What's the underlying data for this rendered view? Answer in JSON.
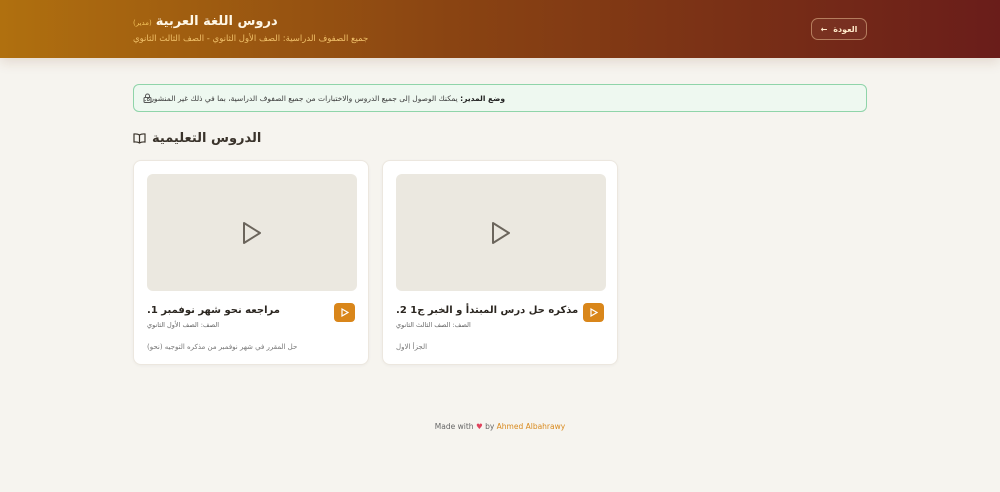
{
  "header": {
    "title": "دروس اللغة العربية",
    "badge": "(مدير)",
    "subtitle": "جميع الصفوف الدراسية: الصف الأول الثانوي - الصف الثالث الثانوي",
    "back_label": "العودة",
    "back_icon": "arrow-left-icon"
  },
  "notice": {
    "bold": "وضع المدير:",
    "text": " يمكنك الوصول إلى جميع الدروس والاختبارات من جميع الصفوف الدراسية، بما في ذلك غير المنشورة.",
    "icon": "lock-icon"
  },
  "section": {
    "title": "الدروس التعليمية",
    "icon": "book-open-icon"
  },
  "lessons": [
    {
      "title": "مراجعه نحو شهر نوفمبر 1.",
      "grade": "الصف: الصف الأول الثانوي",
      "description": "حل المقرر في شهر نوفمبر من مذكره التوجيه (نحو)"
    },
    {
      "title": "مذكره حل درس المبتدأ و الخبر ج1 2.",
      "grade": "الصف: الصف الثالث الثانوي",
      "description": "الجزأ الاول"
    }
  ],
  "footer": {
    "made_with": "Made with",
    "by": "by",
    "author": "Ahmed Albahrawy"
  },
  "colors": {
    "accent": "#d9861a",
    "notice_border": "#8fd4a9"
  }
}
